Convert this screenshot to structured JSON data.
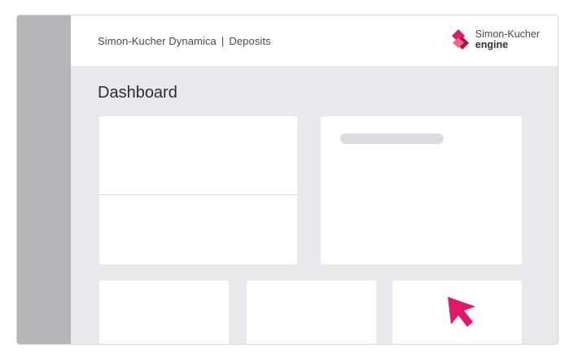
{
  "header": {
    "product": "Simon-Kucher Dynamica",
    "separator": "|",
    "section": "Deposits"
  },
  "logo": {
    "name": "Simon-Kucher",
    "product": "engine",
    "icon": "diamond-logo-icon",
    "colors": [
      "#e3186a",
      "#a9163f",
      "#f06692"
    ]
  },
  "page": {
    "title": "Dashboard"
  },
  "cursor": {
    "icon": "pointer-cursor-icon",
    "color": "#e3186a"
  },
  "colors": {
    "sidebar": "#b6b5b7",
    "background": "#e9e8eb",
    "card": "#ffffff",
    "skeleton": "#dcdbe0"
  }
}
